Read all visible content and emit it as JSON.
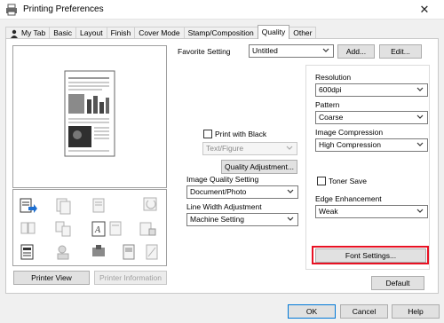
{
  "window": {
    "title": "Printing Preferences",
    "close_glyph": "✕"
  },
  "tabs": [
    {
      "label": "My Tab",
      "active": false
    },
    {
      "label": "Basic",
      "active": false
    },
    {
      "label": "Layout",
      "active": false
    },
    {
      "label": "Finish",
      "active": false
    },
    {
      "label": "Cover Mode",
      "active": false
    },
    {
      "label": "Stamp/Composition",
      "active": false
    },
    {
      "label": "Quality",
      "active": true
    },
    {
      "label": "Other",
      "active": false
    }
  ],
  "favorite": {
    "label": "Favorite Setting",
    "value": "Untitled",
    "add_label": "Add...",
    "edit_label": "Edit..."
  },
  "left_buttons": {
    "printer_view": "Printer View",
    "printer_information": "Printer Information"
  },
  "middle": {
    "print_with_black": "Print with Black",
    "text_figure": "Text/Figure",
    "quality_adjustment": "Quality Adjustment...",
    "image_quality_label": "Image Quality Setting",
    "image_quality_value": "Document/Photo",
    "line_width_label": "Line Width Adjustment",
    "line_width_value": "Machine Setting"
  },
  "right": {
    "resolution_label": "Resolution",
    "resolution_value": "600dpi",
    "pattern_label": "Pattern",
    "pattern_value": "Coarse",
    "image_compression_label": "Image Compression",
    "image_compression_value": "High Compression",
    "toner_save": "Toner Save",
    "edge_label": "Edge Enhancement",
    "edge_value": "Weak",
    "font_settings": "Font Settings..."
  },
  "default_label": "Default",
  "footer": {
    "ok": "OK",
    "cancel": "Cancel",
    "help": "Help"
  },
  "colors": {
    "highlight": "#e81123",
    "accent_blue": "#1e6fd0"
  }
}
